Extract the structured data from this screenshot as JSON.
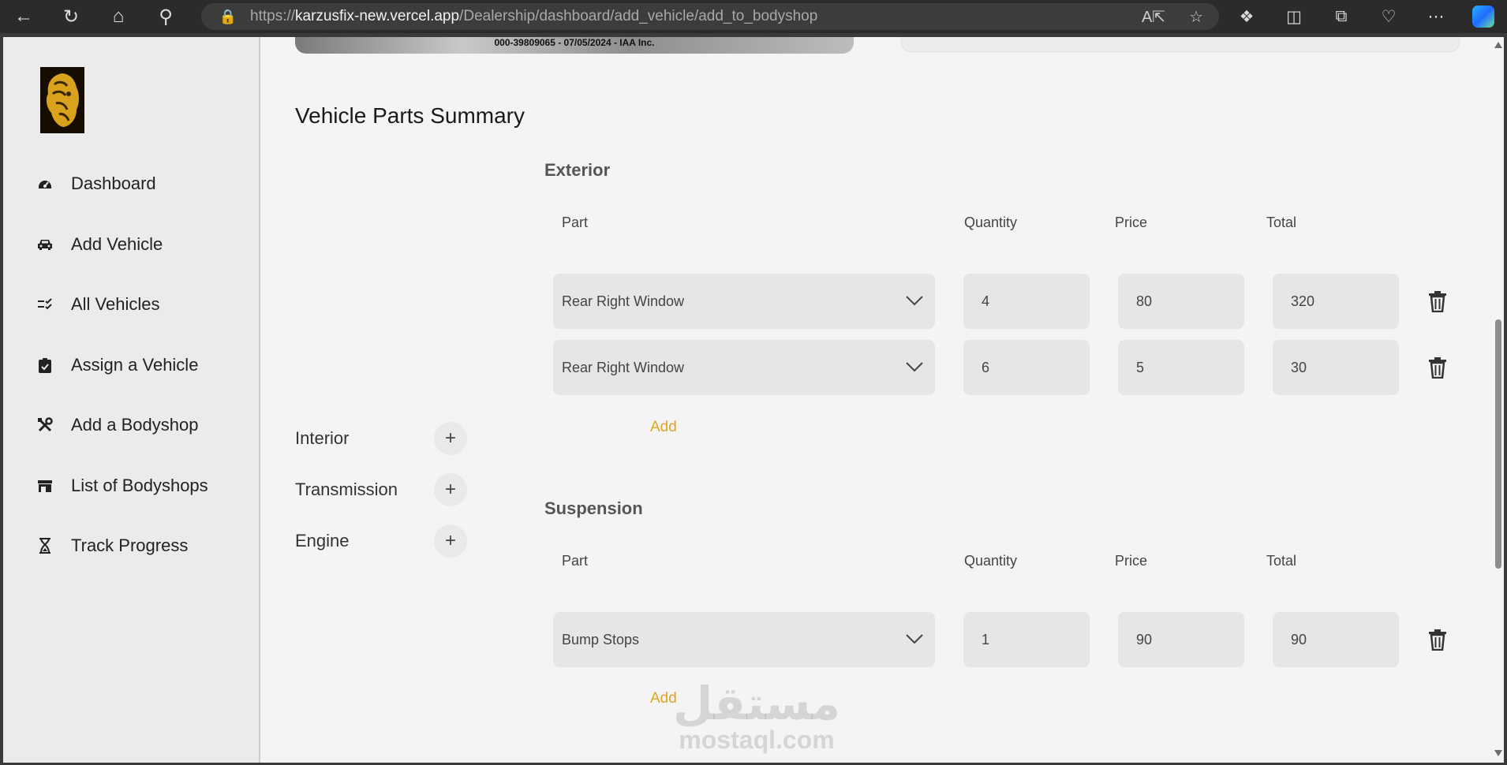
{
  "browser": {
    "url_prefix": "https://",
    "url_host": "karzusfix-new.vercel.app",
    "url_path": "/Dealership/dashboard/add_vehicle/add_to_bodyshop"
  },
  "sidebar": {
    "items": [
      {
        "label": "Dashboard",
        "icon": "gauge-icon"
      },
      {
        "label": "Add Vehicle",
        "icon": "car-icon"
      },
      {
        "label": "All Vehicles",
        "icon": "list-check-icon"
      },
      {
        "label": "Assign a Vehicle",
        "icon": "clipboard-check-icon"
      },
      {
        "label": "Add a Bodyshop",
        "icon": "tools-icon"
      },
      {
        "label": "List of Bodyshops",
        "icon": "store-icon"
      },
      {
        "label": "Track Progress",
        "icon": "hourglass-icon"
      }
    ]
  },
  "photo_caption": "000-39809065 - 07/05/2024 - IAA Inc.",
  "summary": {
    "title": "Vehicle Parts Summary",
    "categories": [
      "Interior",
      "Transmission",
      "Engine"
    ],
    "columns": {
      "part": "Part",
      "quantity": "Quantity",
      "price": "Price",
      "total": "Total"
    },
    "add_label": "Add",
    "sections": [
      {
        "title": "Exterior",
        "rows": [
          {
            "part": "Rear Right Window",
            "quantity": "4",
            "price": "80",
            "total": "320"
          },
          {
            "part": "Rear Right Window",
            "quantity": "6",
            "price": "5",
            "total": "30"
          }
        ]
      },
      {
        "title": "Suspension",
        "rows": [
          {
            "part": "Bump Stops",
            "quantity": "1",
            "price": "90",
            "total": "90"
          }
        ]
      }
    ]
  },
  "watermark": {
    "arabic": "مستقل",
    "latin": "mostaql.com"
  },
  "colors": {
    "accent": "#e2a320",
    "sidebar_bg": "#ebebeb",
    "field_bg": "#e6e6e6"
  }
}
